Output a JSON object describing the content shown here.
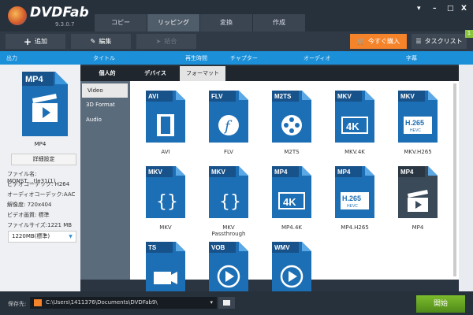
{
  "app": {
    "name": "DVDFab",
    "version": "9.3.0.7"
  },
  "tabs": [
    "コピー",
    "リッピング",
    "変換",
    "作成"
  ],
  "toolbar": {
    "add": "追加",
    "edit": "編集",
    "merge": "結合",
    "buy": "今すぐ購入",
    "tasklist": "タスクリスト",
    "badge": "1"
  },
  "header": {
    "output": "出力",
    "title": "タイトル",
    "duration": "再生時間",
    "chapter": "チャプター",
    "audio": "オーディオ",
    "subtitle": "字幕"
  },
  "left": {
    "icon_label": "MP4",
    "format": "MP4",
    "detail_button": "詳細設定",
    "info": [
      "ファイル名: MONST....tle31(1)",
      "ビデオコーデック: H264",
      "オーディオコーデック:AAC",
      "解像度: 720x404",
      "ビデオ画質: 標準",
      "ファイルサイズ:1221 MB"
    ],
    "size_select": "1220MB(標準)"
  },
  "popup": {
    "tabs": [
      "個人的",
      "デバイス",
      "フォーマット"
    ],
    "side": [
      "Video",
      "3D Format",
      "Audio"
    ],
    "formats": [
      {
        "badge": "AVI",
        "label": "AVI",
        "glyph": "film"
      },
      {
        "badge": "FLV",
        "label": "FLV",
        "glyph": "flash"
      },
      {
        "badge": "M2TS",
        "label": "M2TS",
        "glyph": "reel"
      },
      {
        "badge": "MKV",
        "label": "MKV.4K",
        "glyph": "4K"
      },
      {
        "badge": "MKV",
        "label": "MKV.H265",
        "glyph": "H.265"
      },
      {
        "badge": "MKV",
        "label": "MKV",
        "glyph": "mkv"
      },
      {
        "badge": "MKV",
        "label": "MKV Passthrough",
        "glyph": "mkv"
      },
      {
        "badge": "MP4",
        "label": "MP4.4K",
        "glyph": "4K"
      },
      {
        "badge": "MP4",
        "label": "MP4.H265",
        "glyph": "H.265"
      },
      {
        "badge": "MP4",
        "label": "MP4",
        "glyph": "clap"
      },
      {
        "badge": "TS",
        "label": "",
        "glyph": "camera"
      },
      {
        "badge": "VOB",
        "label": "",
        "glyph": "play"
      },
      {
        "badge": "WMV",
        "label": "",
        "glyph": "play"
      }
    ]
  },
  "bottom": {
    "save_label": "保存先:",
    "path": "C:\\Users\\1411376\\Documents\\DVDFab9\\",
    "start": "開始"
  },
  "colors": {
    "accent": "#1b90d8",
    "buy": "#f5832a",
    "start": "#6aa826",
    "icon": "#1d6fb5"
  }
}
